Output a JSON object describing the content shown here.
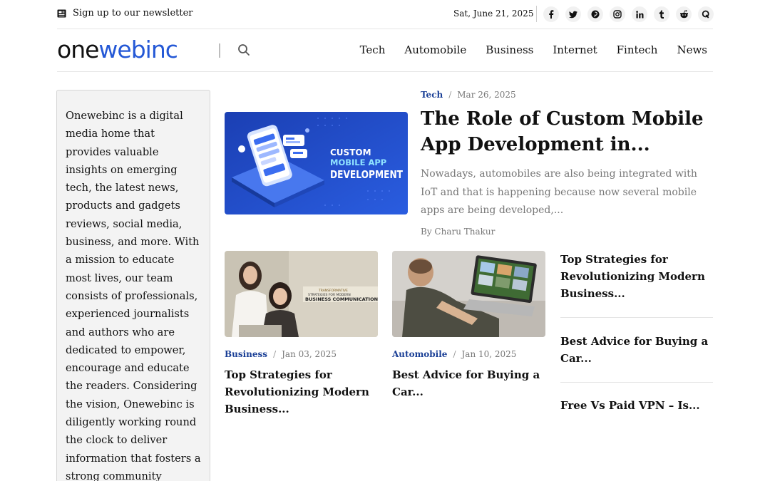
{
  "topbar": {
    "newsletter_label": "Sign up to our newsletter",
    "date": "Sat, June 21, 2025",
    "socials": [
      "facebook-icon",
      "twitter-icon",
      "pinterest-icon",
      "instagram-icon",
      "linkedin-icon",
      "tumblr-icon",
      "reddit-icon",
      "quora-icon"
    ]
  },
  "header": {
    "logo_part1": "one",
    "logo_part2": "webinc",
    "nav": [
      "Tech",
      "Automobile",
      "Business",
      "Internet",
      "Fintech",
      "News"
    ]
  },
  "colors": {
    "brand_blue": "#2458d6",
    "category_blue": "#1a3f96",
    "muted": "#777777"
  },
  "sidebar": {
    "about": "Onewebinc is a digital media home that provides valuable insights on emerging tech, the latest news, products and gadgets reviews, social media, business, and more. With a mission to educate most lives, our team consists of professionals, experienced journalists and authors who are dedicated to empower, encourage and educate the readers. Considering the vision, Onewebinc is diligently working round the clock to deliver information that fosters a strong community together!"
  },
  "featured": {
    "category": "Tech",
    "date": "Mar 26, 2025",
    "title": "The Role of Custom Mobile App Development in...",
    "excerpt": "Nowadays, automobiles are also being integrated with IoT and that is happening because now several mobile apps are being developed,...",
    "author": "By Charu Thakur",
    "image_text": [
      "CUSTOM",
      "MOBILE APP",
      "DEVELOPMENT"
    ]
  },
  "cards": [
    {
      "category": "Business",
      "date": "Jan 03, 2025",
      "title": "Top Strategies for Revolutionizing Modern Business...",
      "image_text": [
        "TRANSFORMATIVE",
        "STRATEGIES FOR MODERN",
        "BUSINESS COMMUNICATION"
      ]
    },
    {
      "category": "Automobile",
      "date": "Jan 10, 2025",
      "title": "Best Advice for Buying a Car..."
    }
  ],
  "side_list": [
    "Top Strategies for Revolutionizing Modern Business...",
    "Best Advice for Buying a Car...",
    "Free Vs Paid VPN – Is..."
  ]
}
